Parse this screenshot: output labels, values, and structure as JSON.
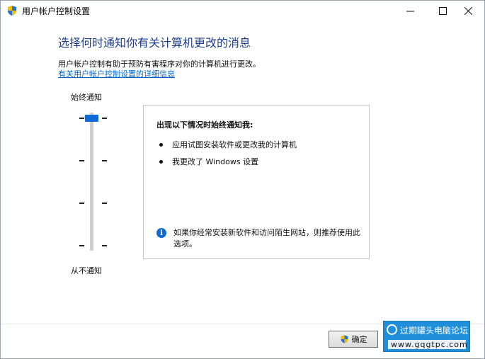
{
  "window": {
    "title": "用户帐户控制设置",
    "controls": {
      "minimize": "—",
      "maximize": "☐",
      "close": "✕"
    }
  },
  "main": {
    "heading": "选择何时通知你有关计算机更改的消息",
    "description": "用户帐户控制有助于预防有害程序对你的计算机进行更改。",
    "link": "有关用户帐户控制设置的详细信息"
  },
  "slider": {
    "top_label": "始终通知",
    "bottom_label": "从不通知",
    "levels": 4,
    "selected_level": 4
  },
  "panel": {
    "title": "出现以下情况时始终通知我:",
    "bullets": [
      "应用试图安装软件或更改我的计算机",
      "我更改了 Windows 设置"
    ],
    "info": "如果你经常安装新软件和访问陌生网站，则推荐使用此选项。"
  },
  "footer": {
    "ok_label": "确定"
  },
  "watermark": {
    "title": "过期罐头电脑论坛",
    "url": "www.gqgtpc.com"
  },
  "colors": {
    "accent": "#0f6ad6",
    "heading": "#1f3d8c",
    "link": "#0066cc"
  }
}
